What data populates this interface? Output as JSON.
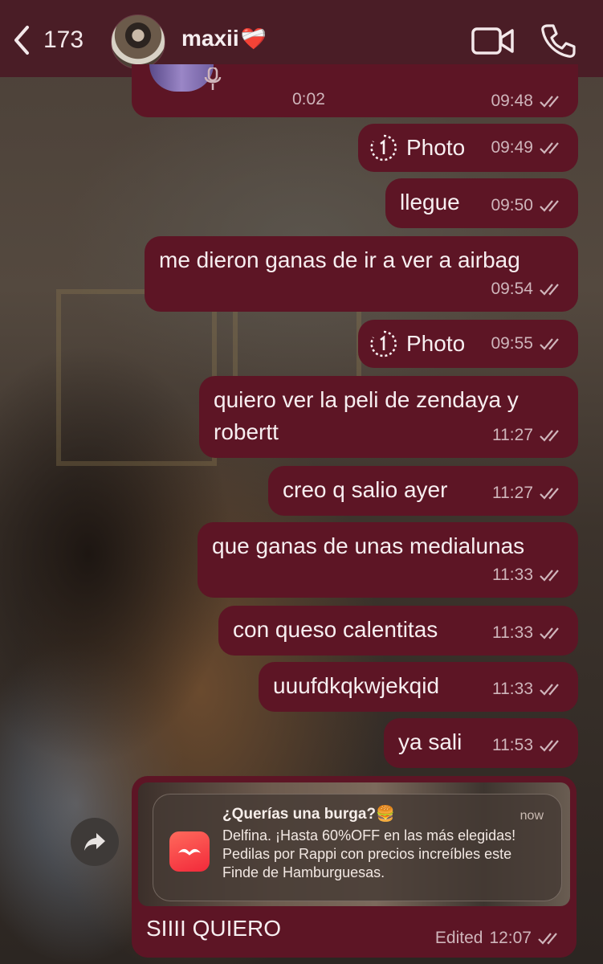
{
  "header": {
    "back_count": "173",
    "contact_name": "maxii",
    "contact_emoji": "❤️‍🩹"
  },
  "voice_message": {
    "duration": "0:02",
    "time": "09:48"
  },
  "messages": [
    {
      "type": "photo",
      "text": "Photo",
      "time": "09:49"
    },
    {
      "type": "text",
      "text": "llegue",
      "time": "09:50"
    },
    {
      "type": "text",
      "text": "me dieron ganas de ir a ver a airbag",
      "time": "09:54"
    },
    {
      "type": "photo",
      "text": "Photo",
      "time": "09:55"
    },
    {
      "type": "text",
      "text": "quiero ver la peli de zendaya y\nrobertt",
      "time": "11:27"
    },
    {
      "type": "text",
      "text": "creo q salio ayer",
      "time": "11:27"
    },
    {
      "type": "text",
      "text": "que ganas de unas medialunas",
      "time": "11:33"
    },
    {
      "type": "text",
      "text": "con queso calentitas",
      "time": "11:33"
    },
    {
      "type": "text",
      "text": "uuufdkqkwjekqid",
      "time": "11:33"
    },
    {
      "type": "text",
      "text": "ya sali",
      "time": "11:53"
    }
  ],
  "last_message": {
    "notification": {
      "title": "¿Querías una burga?🍔",
      "time": "now",
      "body": "Delfina. ¡Hasta 60%OFF en las más elegidas! Pedilas por Rappi con precios increíbles este Finde de Hamburguesas."
    },
    "text": "SIIII QUIERO",
    "edited_label": "Edited",
    "time": "12:07"
  },
  "colors": {
    "header_bg": "#4a1d26",
    "bubble_bg": "#5d1525",
    "meta_text": "#cfb5bb"
  },
  "icons": [
    "chevron-left-icon",
    "video-camera-icon",
    "phone-icon",
    "timer-icon",
    "double-check-icon",
    "microphone-icon",
    "forward-icon",
    "rappi-logo-icon"
  ]
}
